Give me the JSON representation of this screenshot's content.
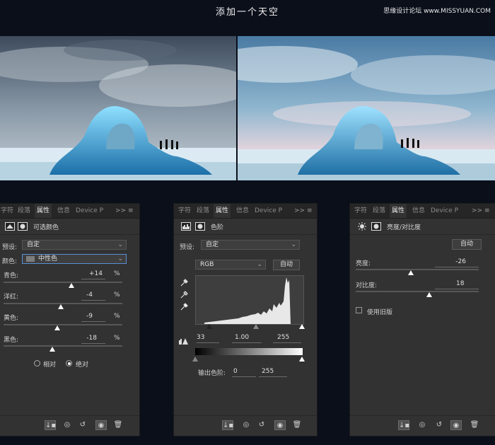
{
  "page": {
    "title": "添加一个天空",
    "watermark": "思缘设计论坛 www.MISSYUAN.COM"
  },
  "photos": {
    "left_alt": "original iceberg photo",
    "right_alt": "iceberg photo with sky added"
  },
  "tabs": [
    "字符",
    "段落",
    "属性",
    "信息",
    "Device P"
  ],
  "tabs_more": ">>",
  "panel1": {
    "header": "可选颜色",
    "preset_label": "预设:",
    "preset_value": "自定",
    "color_label": "颜色:",
    "color_value": "中性色",
    "sliders": [
      {
        "label": "青色:",
        "value": "+14",
        "unit": "%",
        "pos": 0.57
      },
      {
        "label": "洋红:",
        "value": "-4",
        "unit": "%",
        "pos": 0.48
      },
      {
        "label": "黄色:",
        "value": "-9",
        "unit": "%",
        "pos": 0.45
      },
      {
        "label": "黑色:",
        "value": "-18",
        "unit": "%",
        "pos": 0.41
      }
    ],
    "relative_label": "相对",
    "absolute_label": "绝对"
  },
  "panel2": {
    "header": "色阶",
    "preset_label": "预设:",
    "preset_value": "自定",
    "channel_value": "RGB",
    "auto_label": "自动",
    "input_black": "33",
    "input_gamma": "1.00",
    "input_white": "255",
    "output_label": "输出色阶:",
    "output_black": "0",
    "output_white": "255"
  },
  "panel3": {
    "header": "亮度/对比度",
    "auto_label": "自动",
    "brightness_label": "亮度:",
    "brightness_value": "-26",
    "brightness_pos": 0.45,
    "contrast_label": "对比度:",
    "contrast_value": "18",
    "contrast_pos": 0.6,
    "legacy_label": "使用旧版"
  },
  "colors": {
    "panel_bg": "#323232",
    "tab_bg": "#262626",
    "page_bg": "#0a0f1a",
    "accent_focus": "#5a8ed6"
  }
}
